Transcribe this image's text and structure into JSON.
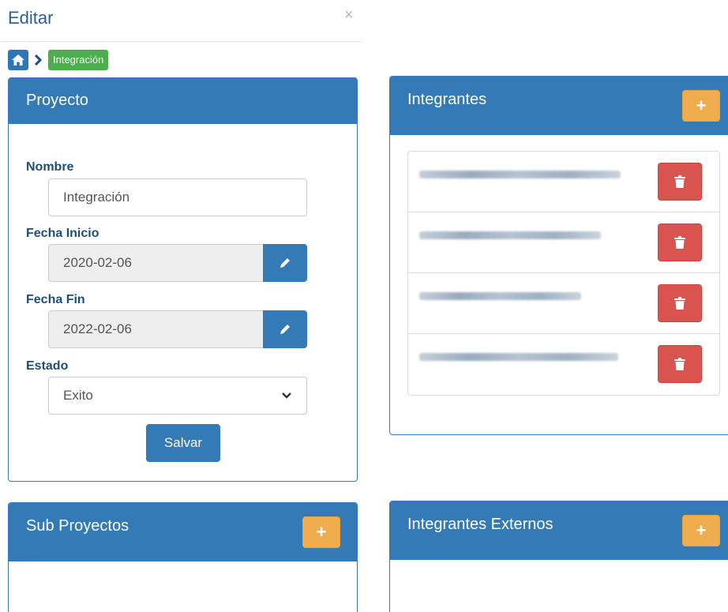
{
  "modal": {
    "title": "Editar",
    "close_symbol": "×"
  },
  "breadcrumb": {
    "current": "Integración"
  },
  "proyecto": {
    "title": "Proyecto",
    "nombre_label": "Nombre",
    "nombre_value": "Integración",
    "fecha_inicio_label": "Fecha Inicio",
    "fecha_inicio_value": "2020-02-06",
    "fecha_fin_label": "Fecha Fin",
    "fecha_fin_value": "2022-02-06",
    "estado_label": "Estado",
    "estado_value": "Exito",
    "save_label": "Salvar"
  },
  "integrantes": {
    "title": "Integrantes",
    "add_symbol": "+"
  },
  "sub_proyectos": {
    "title": "Sub Proyectos",
    "add_symbol": "+"
  },
  "integrantes_externos": {
    "title": "Integrantes Externos",
    "add_symbol": "+"
  },
  "colors": {
    "primary": "#337ab7",
    "warning": "#f0ad4e",
    "danger": "#d9534f",
    "success": "#4cae4c"
  },
  "icons": [
    "home-icon",
    "chevron-right-icon",
    "pencil-icon",
    "trash-icon",
    "plus-icon",
    "chevron-down-icon",
    "close-icon"
  ]
}
